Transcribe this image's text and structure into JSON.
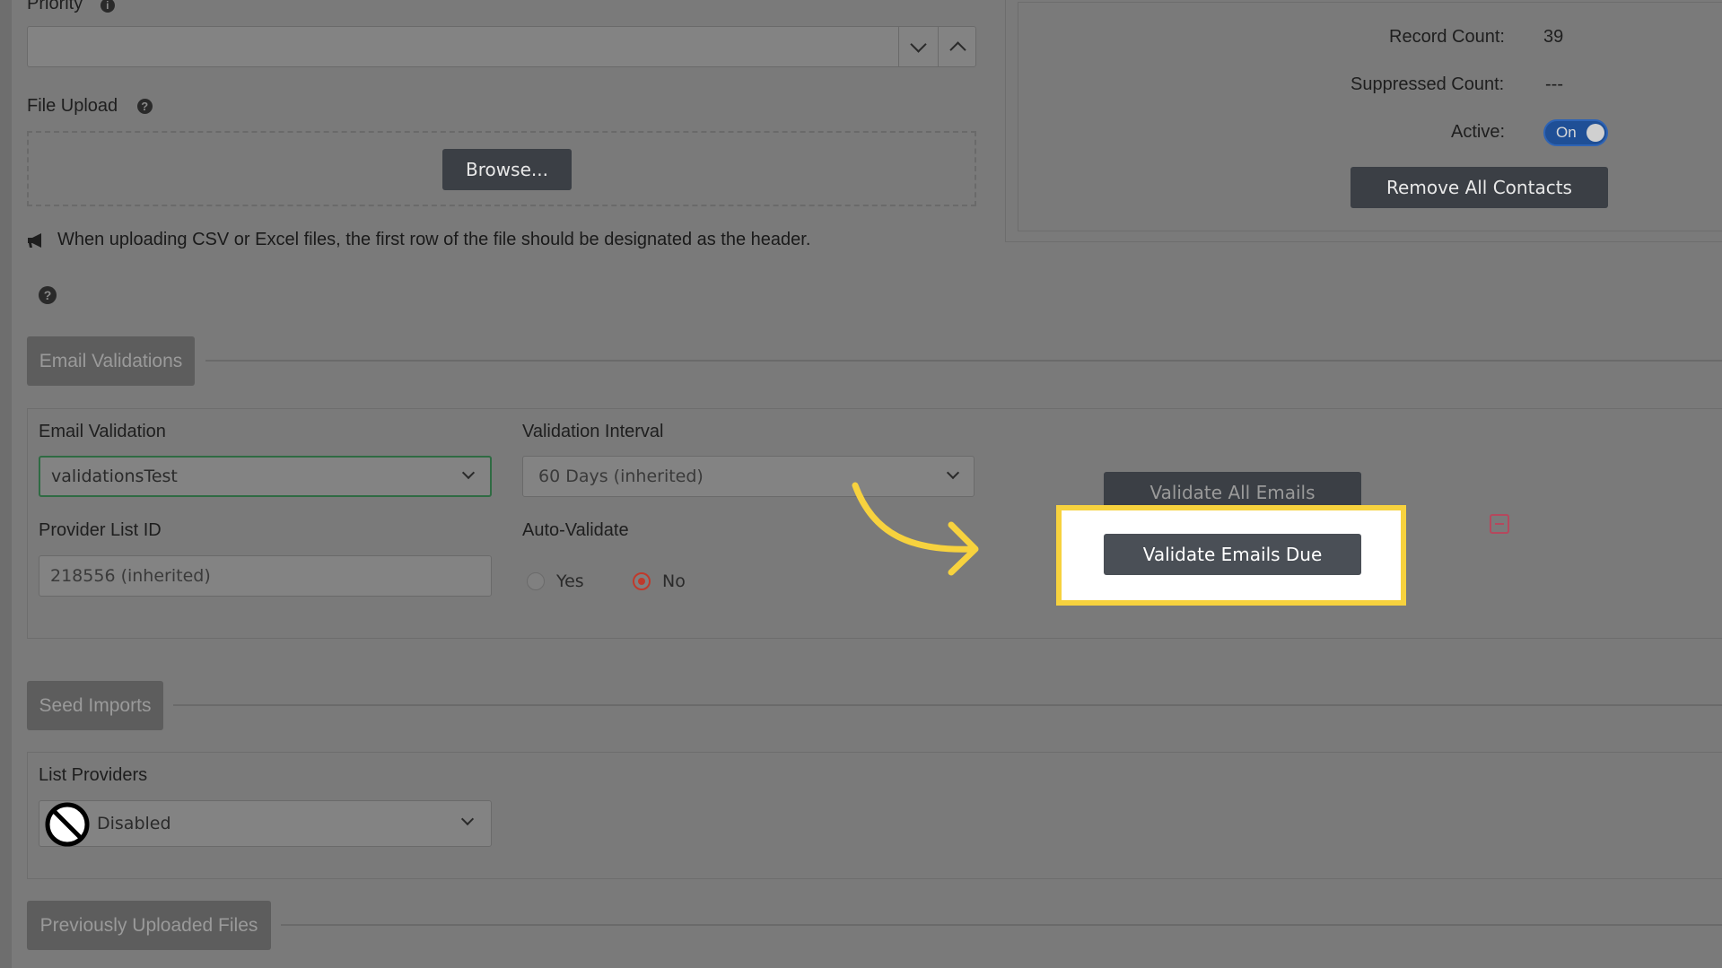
{
  "priority": {
    "label": "Priority"
  },
  "file_upload": {
    "label": "File Upload",
    "browse_label": "Browse...",
    "notice": "When uploading CSV or Excel files, the first row of the file should be designated as the header."
  },
  "stats": {
    "record_count_label": "Record Count:",
    "record_count_value": "39",
    "suppressed_count_label": "Suppressed Count:",
    "suppressed_count_value": "---",
    "active_label": "Active:",
    "active_toggle_label": "On",
    "remove_all_label": "Remove All Contacts"
  },
  "email_validations": {
    "section_title": "Email Validations",
    "email_validation_label": "Email Validation",
    "email_validation_value": "validationsTest",
    "validation_interval_label": "Validation Interval",
    "validation_interval_value": "60 Days (inherited)",
    "provider_list_id_label": "Provider List ID",
    "provider_list_id_value": "218556 (inherited)",
    "auto_validate_label": "Auto-Validate",
    "auto_validate_options": [
      "Yes",
      "No"
    ],
    "auto_validate_selected": "No",
    "validate_all_label": "Validate All Emails",
    "validate_due_label": "Validate Emails Due"
  },
  "seed_imports": {
    "section_title": "Seed Imports",
    "list_providers_label": "List Providers",
    "list_providers_value": "Disabled"
  },
  "previously_uploaded": {
    "section_title": "Previously Uploaded Files"
  },
  "colors": {
    "highlight": "#f7d23e",
    "toggle_on": "#1f4f96",
    "radio_selected": "#c0392b",
    "overlay": "#7a7a7a"
  }
}
